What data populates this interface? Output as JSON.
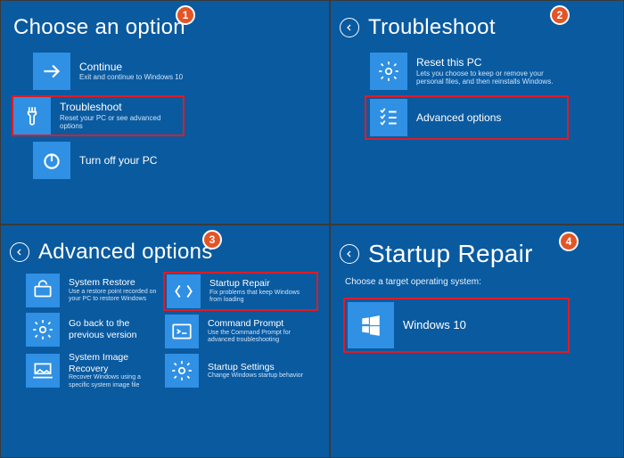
{
  "panels": {
    "choose": {
      "title": "Choose an option",
      "badge": "1",
      "tiles": [
        {
          "label": "Continue",
          "desc": "Exit and continue to Windows 10",
          "icon": "arrow-right"
        },
        {
          "label": "Troubleshoot",
          "desc": "Reset your PC or see advanced options",
          "icon": "wrench",
          "highlight": true
        },
        {
          "label": "Turn off your PC",
          "desc": "",
          "icon": "power"
        }
      ]
    },
    "troubleshoot": {
      "title": "Troubleshoot",
      "badge": "2",
      "tiles": [
        {
          "label": "Reset this PC",
          "desc": "Lets you choose to keep or remove your personal files, and then reinstalls Windows.",
          "icon": "gear"
        },
        {
          "label": "Advanced options",
          "desc": "",
          "icon": "checklist",
          "highlight": true
        }
      ]
    },
    "advanced": {
      "title": "Advanced options",
      "badge": "3",
      "left": [
        {
          "label": "System Restore",
          "desc": "Use a restore point recorded on your PC to restore Windows",
          "icon": "restore"
        },
        {
          "label": "Go back to the previous version",
          "desc": "",
          "icon": "gear"
        },
        {
          "label": "System Image Recovery",
          "desc": "Recover Windows using a specific system image file",
          "icon": "image-recovery"
        }
      ],
      "right": [
        {
          "label": "Startup Repair",
          "desc": "Fix problems that keep Windows from loading",
          "icon": "repair",
          "highlight": true
        },
        {
          "label": "Command Prompt",
          "desc": "Use the Command Prompt for advanced troubleshooting",
          "icon": "cmd"
        },
        {
          "label": "Startup Settings",
          "desc": "Change Windows startup behavior",
          "icon": "gear"
        }
      ]
    },
    "startup": {
      "title": "Startup Repair",
      "badge": "4",
      "subtext": "Choose a target operating system:",
      "tiles": [
        {
          "label": "Windows 10",
          "desc": "",
          "icon": "windows",
          "highlight": true
        }
      ]
    }
  }
}
